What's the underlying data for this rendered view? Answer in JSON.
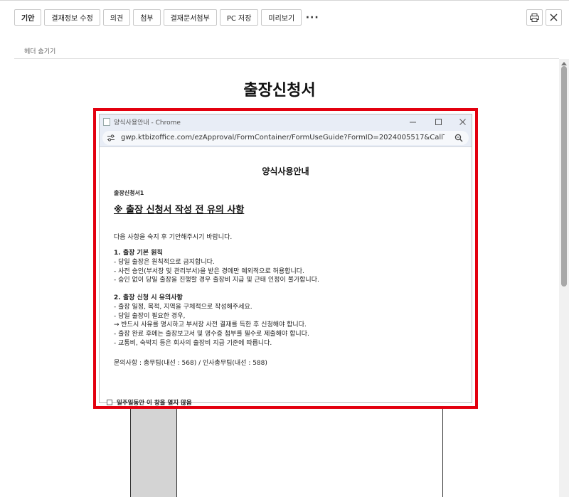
{
  "toolbar": {
    "buttons": [
      "기안",
      "결재정보 수정",
      "의견",
      "첨부",
      "결재문서첨부",
      "PC 저장",
      "미리보기"
    ],
    "more": "···"
  },
  "right_tools": {
    "print_icon": "printer-icon",
    "close_icon": "close-icon"
  },
  "header_toggle": "헤더 숨기기",
  "document": {
    "title": "출장신청서"
  },
  "popup": {
    "window_title": "양식사용안내 - Chrome",
    "url": "gwp.ktbizoffice.com/ezApproval/FormContainer/FormUseGuide?FormID=2024005517&CallTYpe...",
    "heading": "양식사용안내",
    "form_name": "출장신청서1",
    "main_heading": "※ 출장 신청서 작성 전 유의 사항",
    "intro": "다음 사항을 숙지 후 기안해주시기 바랍니다.",
    "section1": {
      "title": "1. 출장 기본 원칙",
      "lines": [
        " - 당일 출장은 원칙적으로 금지합니다.",
        " - 사전 승인(부서장 및 관리부서)을 받은 경에만 예외적으로 허용합니다.",
        " - 승인 없이 당일 출장을 진행할 경우 출장비 지급 및 근태 인정이 불가합니다."
      ]
    },
    "section2": {
      "title": "2. 출장 신청 시 유의사항",
      "lines": [
        "  - 출장 일정, 목적, 지역을 구체적으로 작성해주세요.",
        "  - 당일 출장이 필요한 경우,",
        "     → 반드시 사유를 명시하고 부서장 사전 결재를 득한 후 신청해야 합니다.",
        "  - 출장 완료 후에는 출장보고서 및 영수증 첨부를 필수로 제출해야 합니다.",
        "  - 교통비, 숙박지 등은 회사의 출장비 지급 기준에 따릅니다."
      ]
    },
    "contact": "문의사항 : 총무팀(내선 : 568) / 인사총무팀(내선 : 588)",
    "no_show_label": "일주일동안 이 창을 열지 않음"
  }
}
